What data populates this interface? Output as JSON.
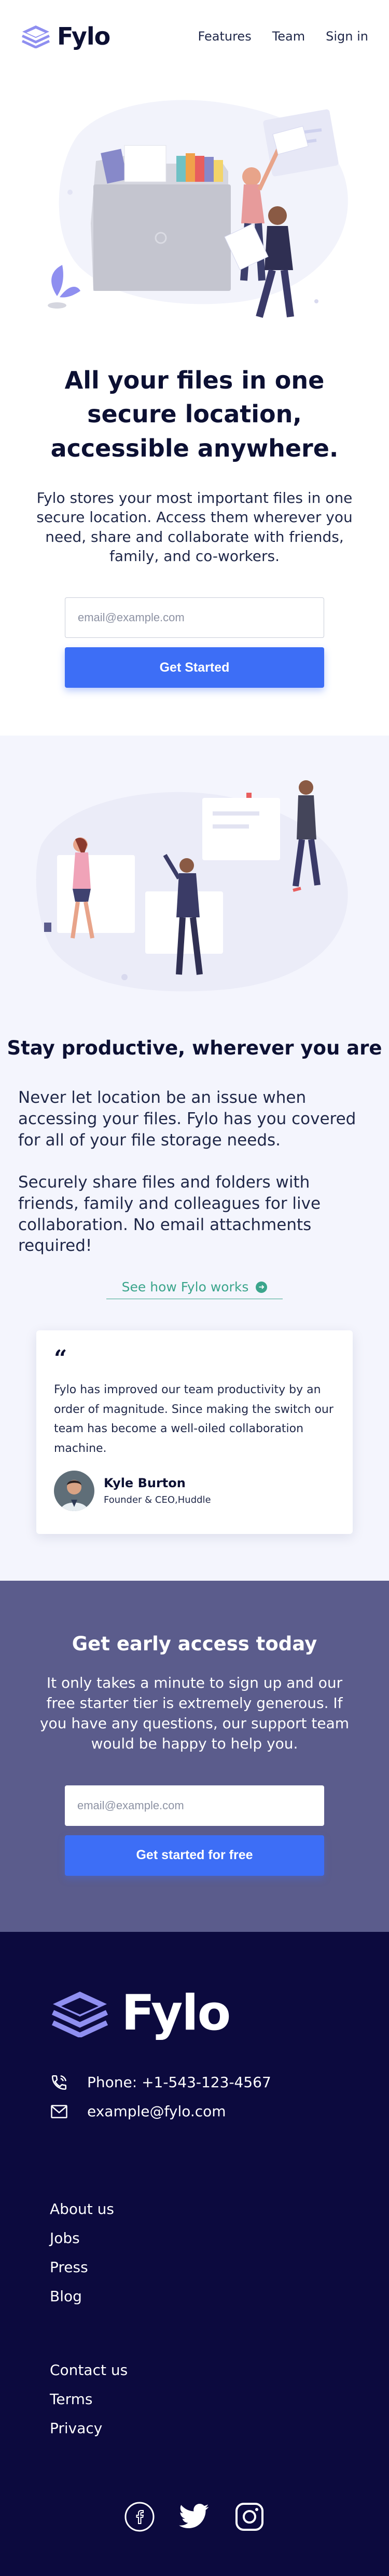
{
  "brand": {
    "name": "Fylo"
  },
  "nav": {
    "features": "Features",
    "team": "Team",
    "signin": "Sign in"
  },
  "hero": {
    "title": "All your files in one secure location, accessible anywhere.",
    "text": "Fylo stores your most important files in one secure location. Access them wherever you need, share and collaborate with friends, family, and co-workers.",
    "email_placeholder": "email@example.com",
    "cta": "Get Started"
  },
  "productive": {
    "title": "Stay productive, wherever you are",
    "p1": "Never let location be an issue when accessing your files. Fylo has you covered for all of your file storage needs.",
    "p2": "Securely share files and folders with friends, family and colleagues for live collaboration. No email attachments required!",
    "link": "See how Fylo works"
  },
  "testimonial": {
    "quote_mark": "“",
    "text": "Fylo has improved our team productivity by an order of magnitude. Since making the switch our team has become a well-oiled collaboration machine.",
    "name": "Kyle Burton",
    "role": "Founder & CEO,Huddle"
  },
  "early": {
    "title": "Get early access today",
    "text": "It only takes a minute to sign up and our free starter tier is extremely generous. If you have any questions, our support team would be happy to help you.",
    "email_placeholder": "email@example.com",
    "cta": "Get started for free"
  },
  "footer": {
    "phone": "Phone: +1-543-123-4567",
    "email": "example@fylo.com",
    "links_1": [
      "About us",
      "Jobs",
      "Press",
      "Blog"
    ],
    "links_2": [
      "Contact us",
      "Terms",
      "Privacy"
    ],
    "socials": [
      "facebook-icon",
      "twitter-icon",
      "instagram-icon"
    ]
  },
  "colors": {
    "accent": "#3d6ef6",
    "link_green": "#3ba58c",
    "navy": "#0c1033",
    "early_bg": "#5b5c8c",
    "footer_bg": "#0c0a3e",
    "productive_bg": "#f4f5fd"
  }
}
